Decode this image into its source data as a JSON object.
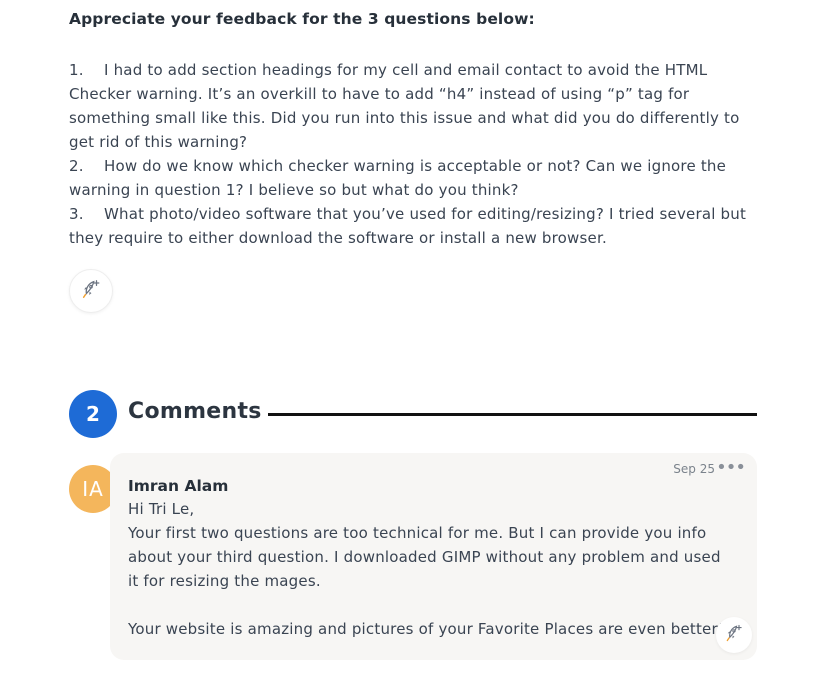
{
  "post": {
    "heading": "Appreciate your feedback for the 3 questions below:",
    "questions": [
      {
        "number": "1.",
        "text": "I had to add section headings for my cell and email contact to avoid the HTML Checker warning.  It’s an overkill to have to add “h4” instead of using “p” tag for something small like this. Did you run into this issue and what did you do differently to get rid of this warning?"
      },
      {
        "number": "2.",
        "text": "How do we know which checker warning is acceptable or not?  Can we ignore the warning in question 1?  I believe so but what do you think?"
      },
      {
        "number": "3.",
        "text": "What photo/video software that you’ve used for editing/resizing?  I tried several but they require to either download the software or install a new browser."
      }
    ],
    "reaction_icon": "rocket-add-reaction-icon"
  },
  "comments_section": {
    "count": "2",
    "title": "Comments"
  },
  "comment": {
    "avatar_initials": "IA",
    "avatar_color": "#f4b65c",
    "author": "Imran Alam",
    "date": "Sep 25",
    "menu_glyph": "•••",
    "body_lines": [
      "Hi Tri Le,",
      "Your first two questions are too technical for me. But I can provide you info",
      "about your third question. I downloaded GIMP without any problem and used",
      "it for resizing the mages.",
      "",
      "Your website is amazing and pictures of your Favorite Places are even better!"
    ],
    "reaction_icon": "rocket-add-reaction-icon"
  },
  "colors": {
    "badge": "#1e6bd6",
    "card_background": "#f7f6f4",
    "text": "#3a4452"
  }
}
